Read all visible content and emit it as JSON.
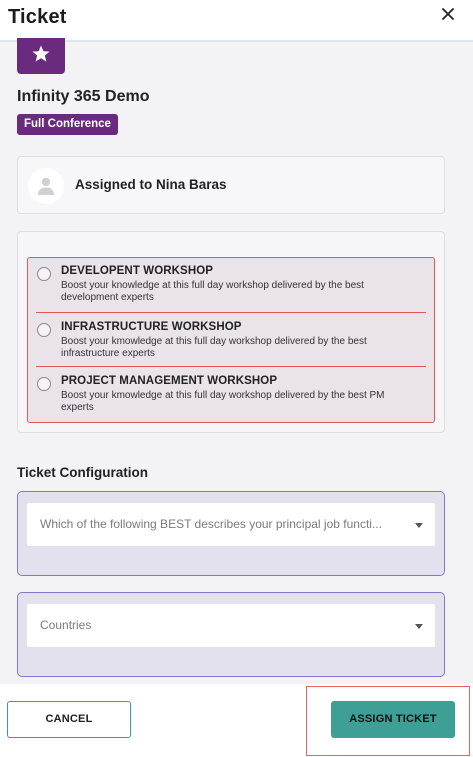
{
  "header": {
    "title": "Ticket",
    "close_icon": "close-icon"
  },
  "event": {
    "logo_icon": "ticket-star-icon",
    "name": "Infinity 365 Demo",
    "badge": "Full Conference"
  },
  "assignment": {
    "avatar_icon": "user-avatar-icon",
    "text": "Assigned to Nina Baras"
  },
  "workshops": [
    {
      "title": "DEVELOPENT WORKSHOP",
      "description": "Boost your knowledge at this full day workshop delivered by the best development experts",
      "selected": false
    },
    {
      "title": "INFRASTRUCTURE WORKSHOP",
      "description": "Boost your kmowledge at this full day workshop delivered by the best infrastructure experts",
      "selected": false
    },
    {
      "title": "PROJECT MANAGEMENT WORKSHOP",
      "description": "Boost your kmowledge at this full day workshop delivered by the best PM experts",
      "selected": false
    }
  ],
  "configuration": {
    "title": "Ticket Configuration",
    "fields": [
      {
        "placeholder": "Which of the following BEST describes your principal job functi...",
        "icon": "chevron-down-icon"
      },
      {
        "placeholder": "Countries",
        "icon": "chevron-down-icon"
      }
    ]
  },
  "footer": {
    "cancel_label": "CANCEL",
    "assign_label": "ASSIGN TICKET"
  },
  "colors": {
    "brand_purple": "#6a2a7e",
    "accent_teal": "#3e9f96",
    "highlight_red": "#e05a5a",
    "select_border": "#8a76c8"
  }
}
